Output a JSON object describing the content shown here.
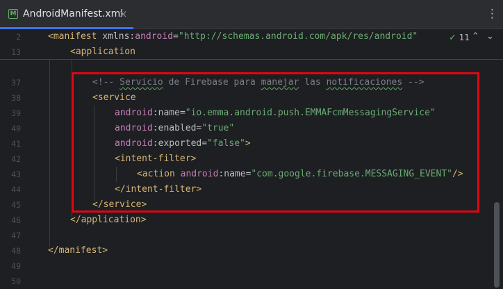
{
  "tab": {
    "icon_letter": "M",
    "title": "AndroidManifest.xml",
    "close_glyph": "×"
  },
  "menu_glyph": "⋮",
  "inspections": {
    "check_glyph": "✓",
    "count": "11",
    "up_glyph": "⌃",
    "down_glyph": "⌄"
  },
  "sticky": {
    "line_numbers": [
      "2",
      "13"
    ],
    "manifest": {
      "open": "<manifest",
      "xmlns": "xmlns",
      "colon": ":",
      "attr": "android",
      "eq": "=",
      "value": "\"http://schemas.android.com/apk/res/android\""
    },
    "application": "<application"
  },
  "line_numbers": [
    "37",
    "38",
    "39",
    "40",
    "41",
    "42",
    "43",
    "44",
    "45",
    "46",
    "47",
    "48",
    "49",
    "50"
  ],
  "code": {
    "comment_start": "<!-- ",
    "comment_w1": "Servicio",
    "comment_w2": " de Firebase para ",
    "comment_w3": "manejar",
    "comment_w4": " las ",
    "comment_w5": "notificaciones",
    "comment_end": " -->",
    "service_open": "<service",
    "ns": "android",
    "colon": ":",
    "eq": "=",
    "attr_name": "name",
    "service_name": "\"io.emma.android.push.EMMAFcmMessagingService\"",
    "attr_enabled": "enabled",
    "enabled_value": "\"true\"",
    "attr_exported": "exported",
    "exported_value": "\"false\"",
    "gt": ">",
    "intent_open": "<intent-filter",
    "action_open": "<action ",
    "action_value": "\"com.google.firebase.MESSAGING_EVENT\"",
    "self_close": "/>",
    "intent_close": "</intent-filter>",
    "service_close": "</service>",
    "application_close": "</application>",
    "manifest_close": "</manifest>"
  }
}
